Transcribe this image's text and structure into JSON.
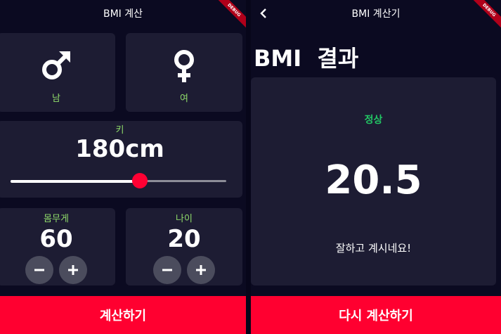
{
  "colors": {
    "background": "#0b0a21",
    "card": "#1d1c33",
    "accent": "#ff0030",
    "label_green": "#8fdc6a",
    "status_green": "#22c564",
    "round_button": "#4b4c5d"
  },
  "debug_banner": "DEBUG",
  "input_screen": {
    "app_title": "BMI 계산",
    "gender": {
      "male": {
        "label": "남",
        "icon": "male-symbol-icon"
      },
      "female": {
        "label": "여",
        "icon": "female-symbol-icon"
      }
    },
    "height": {
      "label": "키",
      "value_text": "180cm",
      "slider_fraction": 0.6
    },
    "weight": {
      "label": "몸무게",
      "value": "60",
      "minus_icon": "minus-icon",
      "plus_icon": "plus-icon"
    },
    "age": {
      "label": "나이",
      "value": "20",
      "minus_icon": "minus-icon",
      "plus_icon": "plus-icon"
    },
    "calculate_button": "계산하기"
  },
  "result_screen": {
    "app_title": "BMI 계산기",
    "back_icon": "chevron-left-icon",
    "heading": "BMI  결과",
    "status": "정상",
    "bmi_value": "20.5",
    "message": "잘하고 계시네요!",
    "recalculate_button": "다시 계산하기"
  }
}
